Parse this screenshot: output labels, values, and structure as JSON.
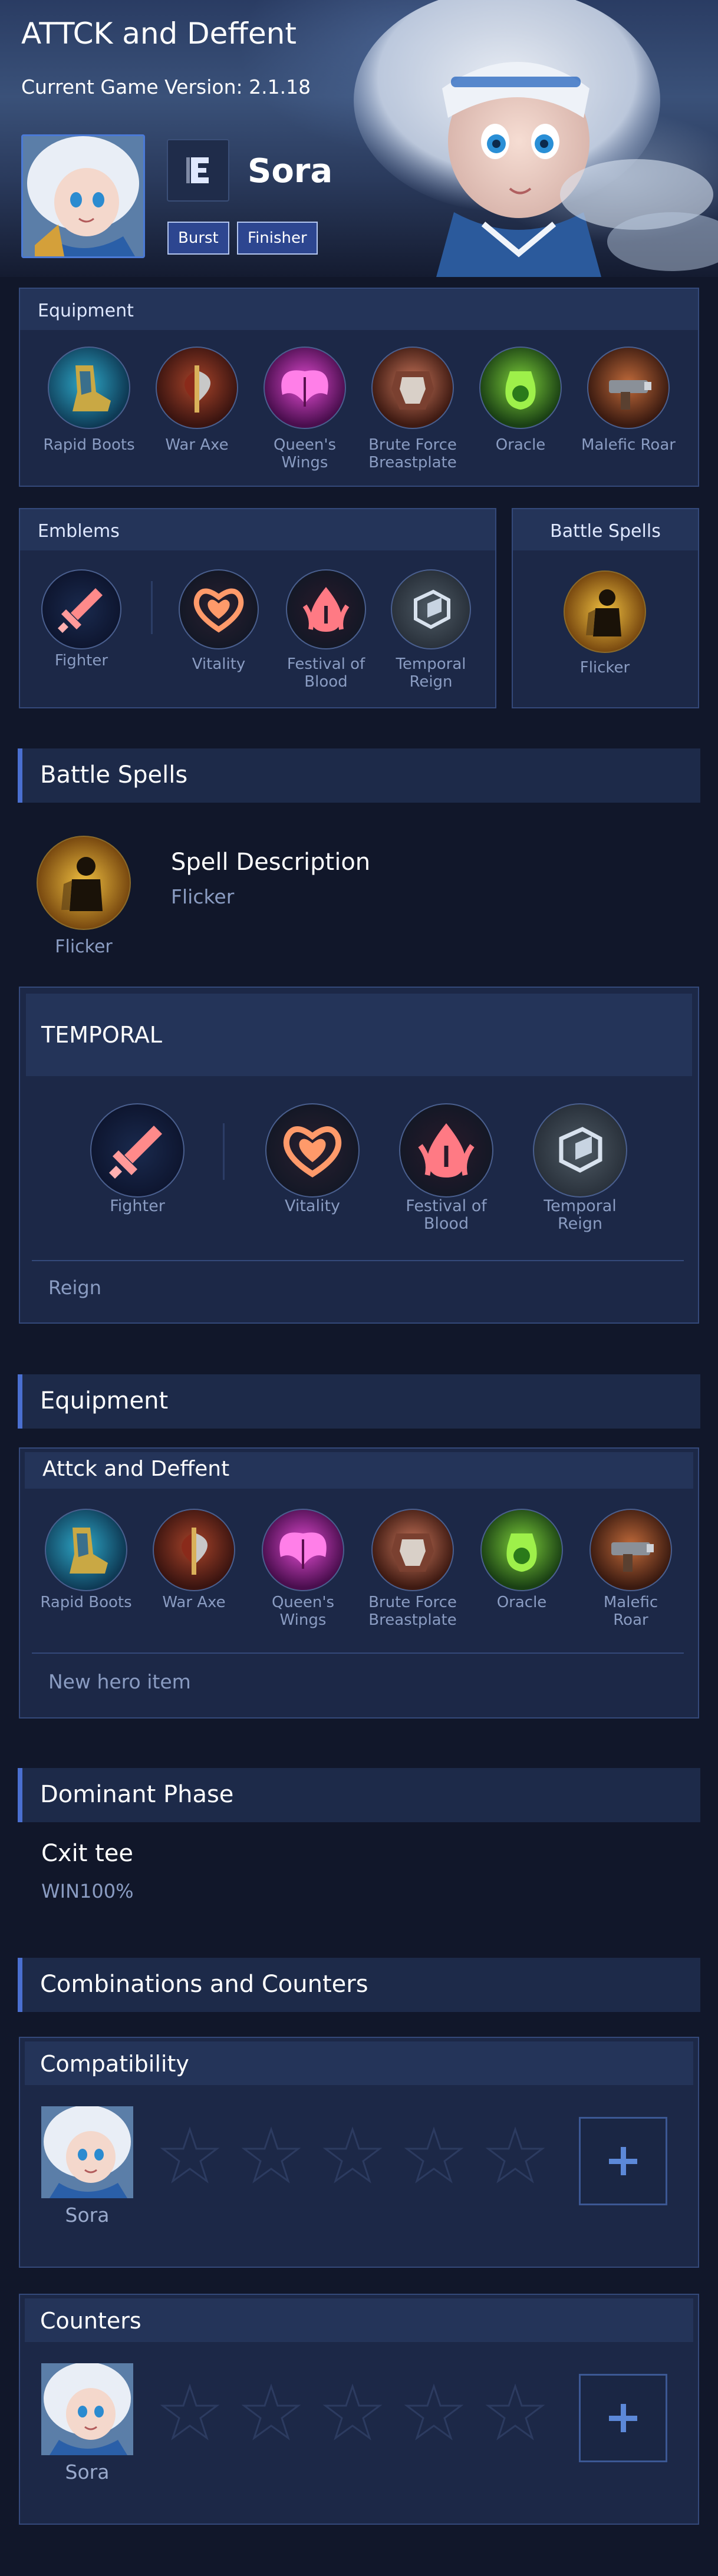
{
  "hero": {
    "title": "ATTCK and Deffent",
    "version": "Current Game Version: 2.1.18",
    "name": "Sora",
    "tags": [
      "Burst",
      "Finisher"
    ],
    "role_icon": "role-icon"
  },
  "equipment_panel": {
    "title": "Equipment",
    "items": [
      "Rapid Boots",
      "War Axe",
      "Queen's Wings",
      "Brute Force Breastplate",
      "Oracle",
      "Malefic Roar"
    ]
  },
  "emblems_panel": {
    "title": "Emblems",
    "main": "Fighter",
    "talents": [
      "Vitality",
      "Festival of Blood",
      "Temporal Reign"
    ]
  },
  "spells_panel": {
    "title": "Battle Spells",
    "spell": "Flicker"
  },
  "battle_spells": {
    "section_title": "Battle Spells",
    "spell_name": "Flicker",
    "description_title": "Spell Description",
    "description_value": "Flicker"
  },
  "temporal": {
    "title": "TEMPORAL",
    "main": "Fighter",
    "talents": [
      "Vitality",
      "Festival of Blood",
      "Temporal Reign"
    ],
    "note": "Reign"
  },
  "equipment_section": {
    "section_title": "Equipment",
    "build_title": "Attck and Deffent",
    "items": [
      "Rapid Boots",
      "War Axe",
      "Queen's Wings",
      "Brute Force Breastplate",
      "Oracle",
      "Malefic Roar"
    ],
    "note": "New hero item"
  },
  "dominant": {
    "section_title": "Dominant Phase",
    "label": "Cxit tee",
    "value": "WIN100%"
  },
  "combos": {
    "section_title": "Combinations and Counters",
    "compatibility": {
      "title": "Compatibility",
      "hero": "Sora",
      "stars": 0,
      "max_stars": 5
    },
    "counters": {
      "title": "Counters",
      "hero": "Sora",
      "stars": 0,
      "max_stars": 5
    }
  },
  "colors": {
    "accent": "#4a6fd0",
    "panel": "#1c2847",
    "background": "#11172a"
  }
}
